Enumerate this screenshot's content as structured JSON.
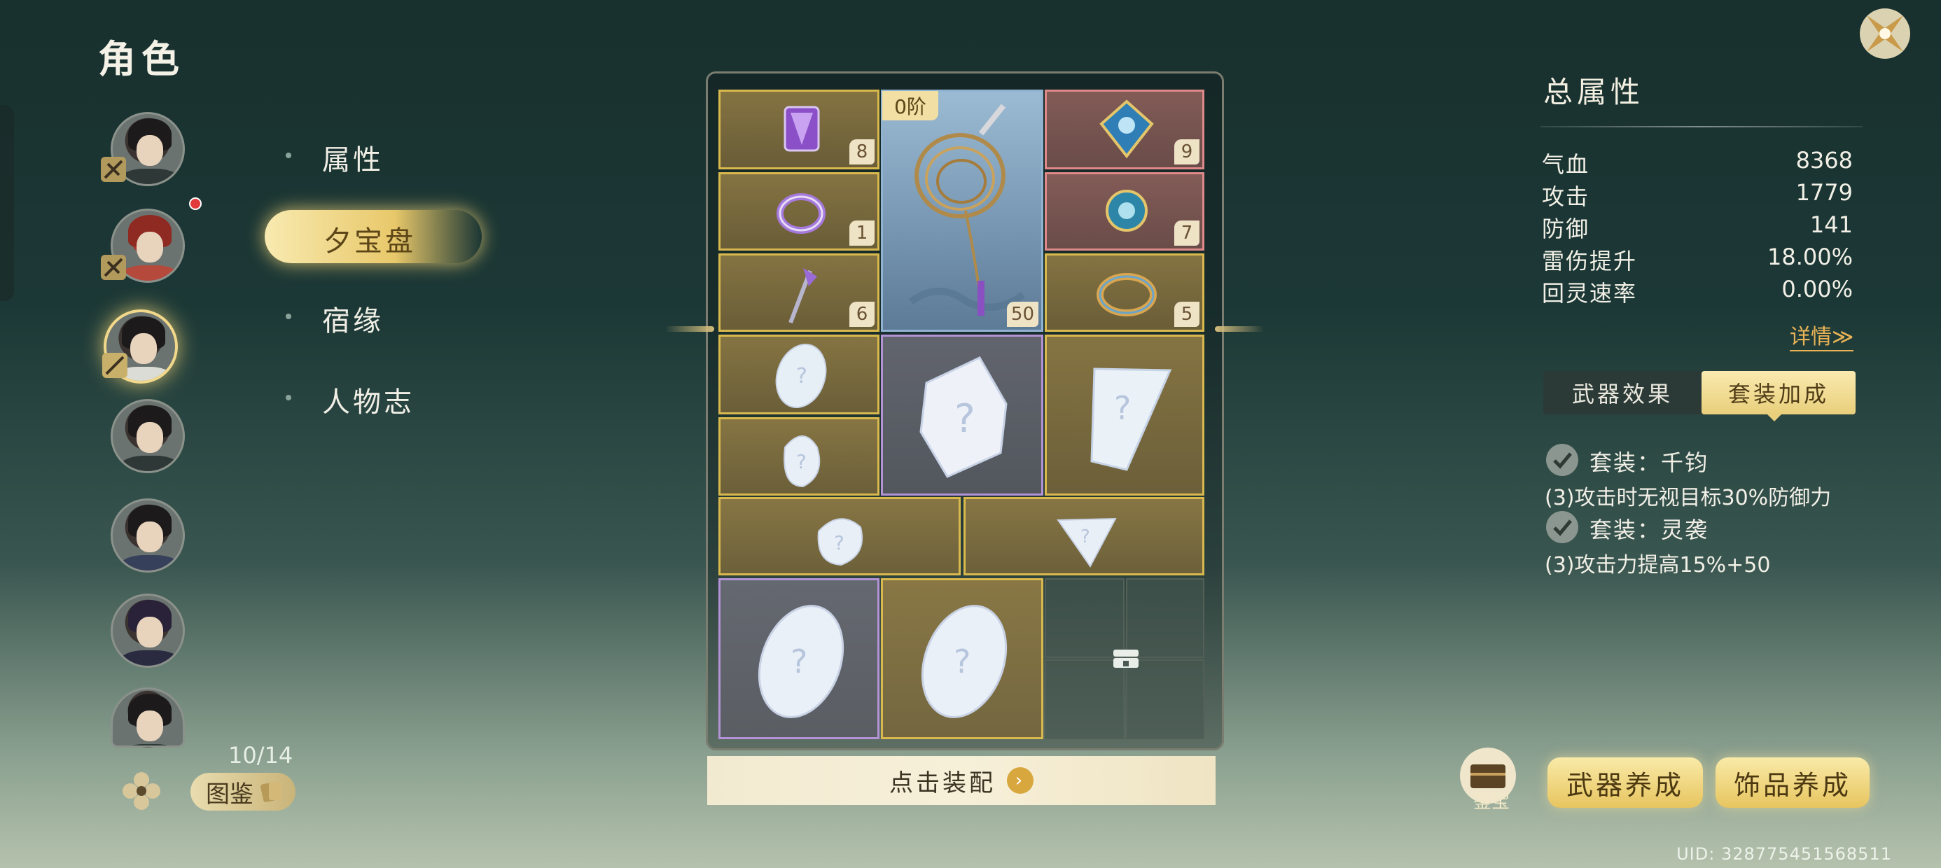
{
  "header": {
    "title": "角色"
  },
  "roster": {
    "count": "10/14",
    "atlas_label": "图鉴"
  },
  "menu": {
    "items": [
      {
        "label": "属性"
      },
      {
        "label": "夕宝盘"
      },
      {
        "label": "宿缘"
      },
      {
        "label": "人物志"
      }
    ],
    "selected_index": 1
  },
  "board": {
    "weapon_stage": "0阶",
    "weapon_level": "50",
    "slot_counts": {
      "top_left": "8",
      "mid_left": "1",
      "low_left": "6",
      "top_right": "9",
      "mid_right": "7",
      "low_right": "5"
    },
    "equip_label": "点击装配"
  },
  "attributes": {
    "title": "总属性",
    "stats": [
      {
        "label": "气血",
        "value": "8368"
      },
      {
        "label": "攻击",
        "value": "1779"
      },
      {
        "label": "防御",
        "value": "141"
      },
      {
        "label": "雷伤提升",
        "value": "18.00%"
      },
      {
        "label": "回灵速率",
        "value": "0.00%"
      }
    ],
    "detail_link": "详情≫"
  },
  "tabs": {
    "weapon_effect": "武器效果",
    "set_bonus": "套装加成"
  },
  "sets": [
    {
      "name": "套装：千钧",
      "desc": "(3)攻击时无视目标30%防御力"
    },
    {
      "name": "套装：灵袭",
      "desc": "(3)攻击力提高15%+50"
    }
  ],
  "actions": {
    "treasure": "鉴宝",
    "weapon_upgrade": "武器养成",
    "accessory_upgrade": "饰品养成"
  },
  "footer": {
    "uid": "UID: 328775451568511"
  },
  "colors": {
    "accent_gold": "#e9cf7b",
    "slot_gold": "#d9b94d",
    "slot_pink": "#e0898a",
    "slot_purple": "#b393d6",
    "detail_orange": "#e9b355"
  }
}
